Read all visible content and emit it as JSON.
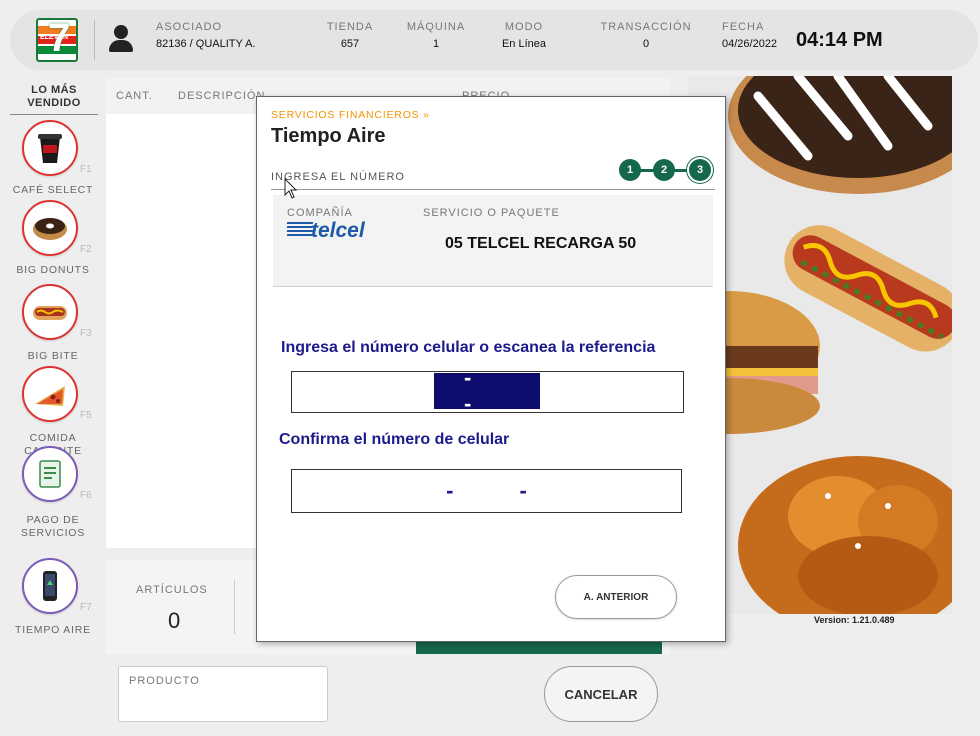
{
  "header": {
    "associate_label": "ASOCIADO",
    "associate_value": "82136  / QUALITY A.",
    "store_label": "TIENDA",
    "store_value": "657",
    "machine_label": "MÁQUINA",
    "machine_value": "1",
    "mode_label": "MODO",
    "mode_value": "En Línea",
    "transaction_label": "TRANSACCIÓN",
    "transaction_value": "0",
    "date_label": "FECHA",
    "date_value": "04/26/2022",
    "time_value": "04:14 PM",
    "logo_text": "7",
    "logo_subtext": "ELEVEN",
    "colors": {
      "brand_green": "#16684a",
      "brand_orange": "#f47b20",
      "brand_red": "#e2231a"
    }
  },
  "sidebar": {
    "title": "LO MÁS VENDIDO",
    "items": [
      {
        "label": "CAFÉ SELECT",
        "key": "F1",
        "icon": "coffee-cup-icon"
      },
      {
        "label": "BIG DONUTS",
        "key": "F2",
        "icon": "donut-icon"
      },
      {
        "label": "BIG BITE",
        "key": "F3",
        "icon": "hotdog-icon"
      },
      {
        "label": "COMIDA CALIENTE",
        "key": "F5",
        "icon": "pizza-icon"
      },
      {
        "label": "PAGO DE SERVICIOS",
        "key": "F6",
        "icon": "bill-icon"
      },
      {
        "label": "TIEMPO AIRE",
        "key": "F7",
        "icon": "phone-icon"
      }
    ]
  },
  "ticket": {
    "col_qty": "CANT.",
    "col_desc": "DESCRIPCIÓN",
    "col_price": "PRECIO"
  },
  "totals": {
    "articles_label": "ARTÍCULOS",
    "articles_value": "0"
  },
  "product": {
    "label": "PRODUCTO"
  },
  "cancel_label": "CANCELAR",
  "version": "Version: 1.21.0.489",
  "modal": {
    "breadcrumb": "SERVICIOS FINANCIEROS »",
    "title": "Tiempo Aire",
    "step_label": "INGRESA EL NÚMERO",
    "steps": [
      "1",
      "2",
      "3"
    ],
    "active_step": 3,
    "company_label": "COMPAÑÍA",
    "company_value": "telcel",
    "service_label": "SERVICIO O PAQUETE",
    "service_value": "05 TELCEL RECARGA 50",
    "prompt_number": "Ingresa el número celular o escanea la referencia",
    "number_value": "- -",
    "prompt_confirm": "Confirma el número de celular",
    "confirm_value": "- -",
    "prev_button": "A. ANTERIOR"
  }
}
